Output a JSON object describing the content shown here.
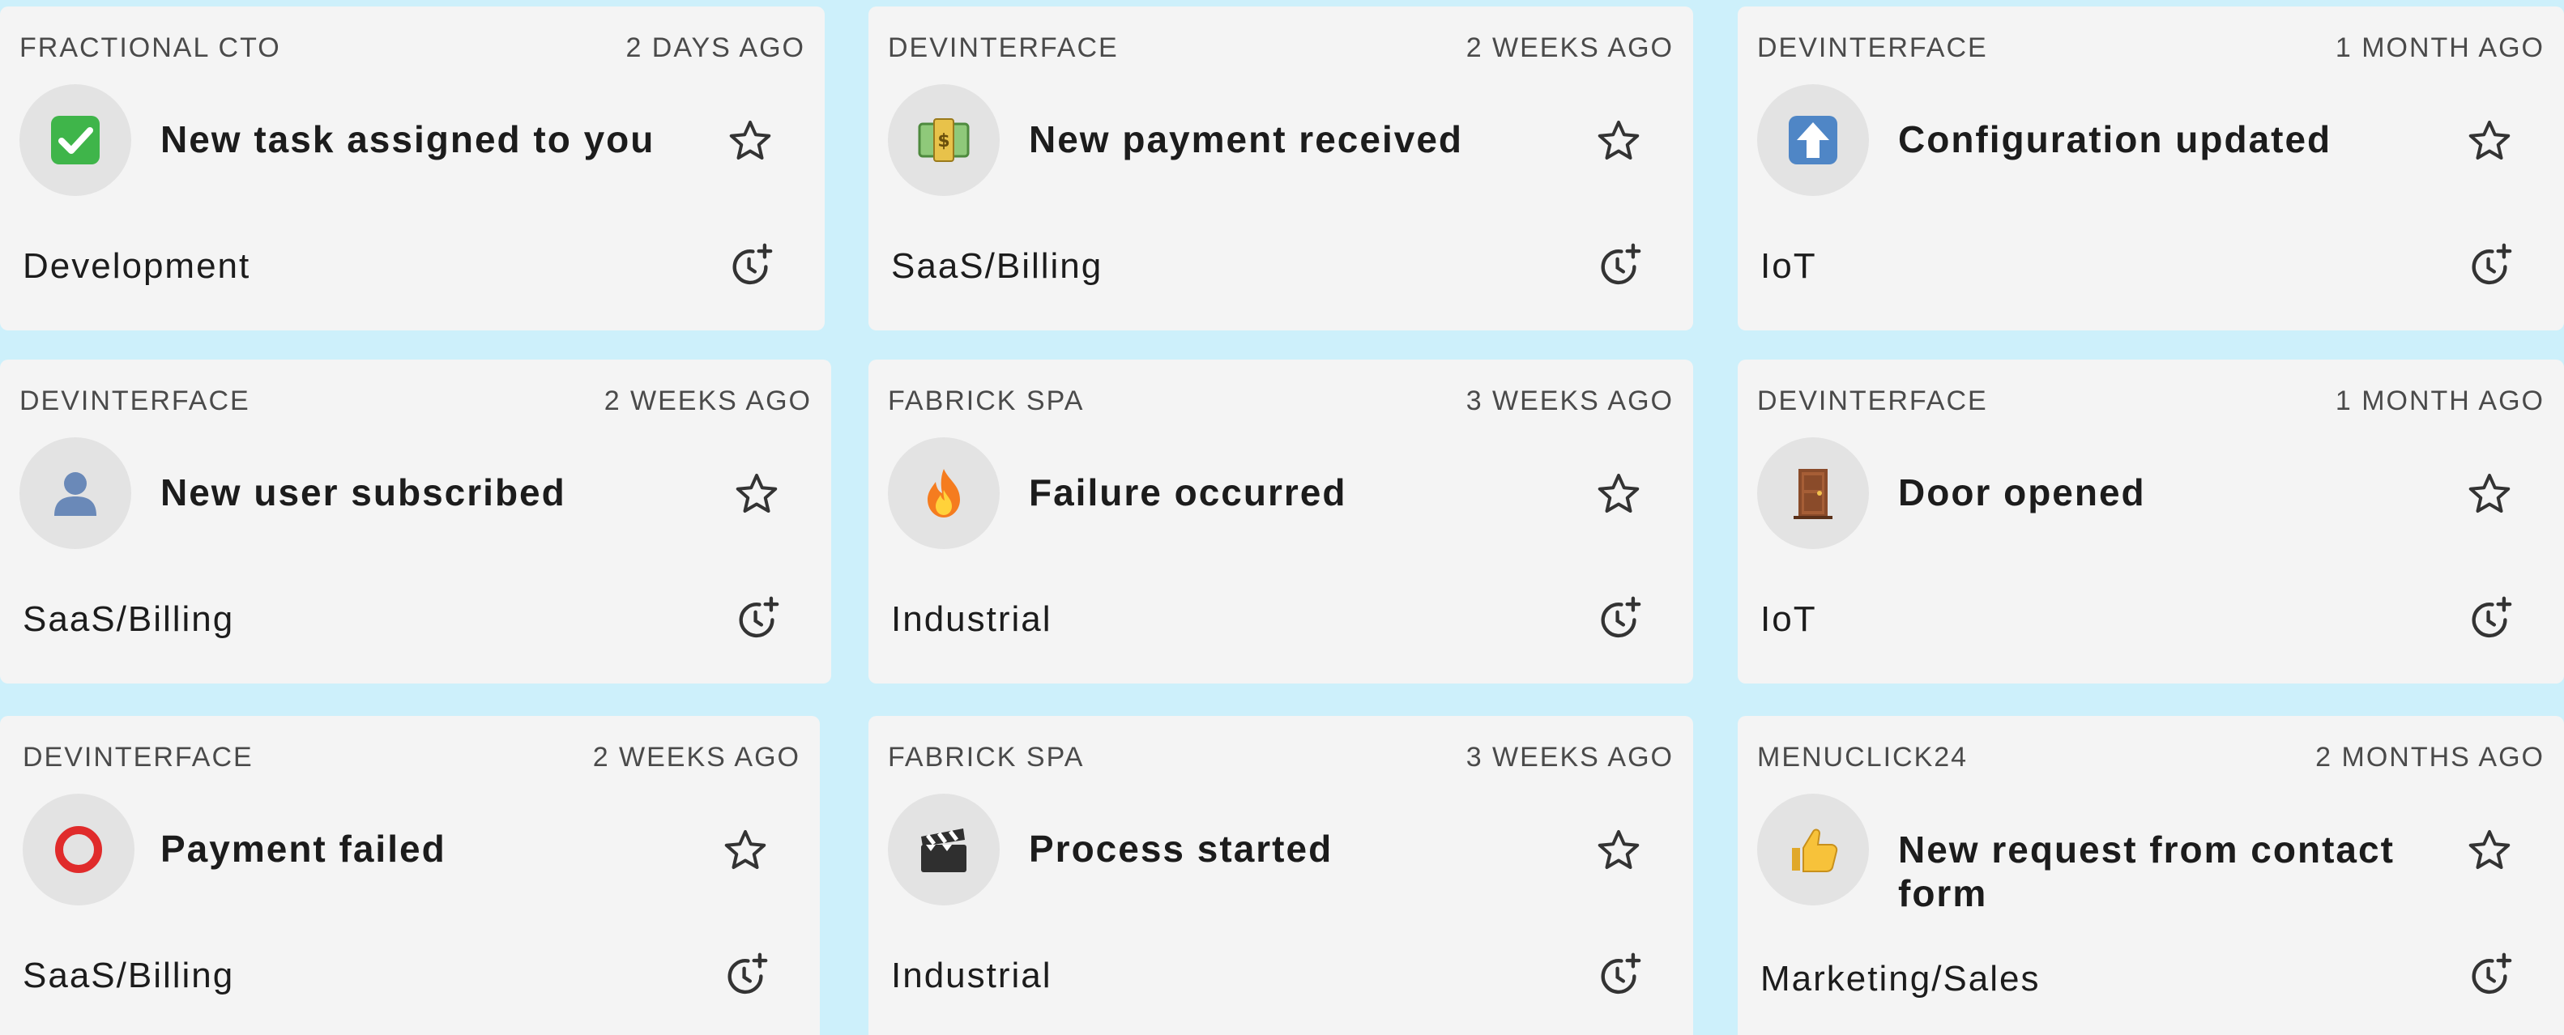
{
  "notifications": [
    {
      "org": "FRACTIONAL CTO",
      "time": "2 DAYS AGO",
      "icon": "check-mark-icon",
      "title": "New task assigned to you",
      "category": "Development"
    },
    {
      "org": "DEVINTERFACE",
      "time": "2 WEEKS AGO",
      "icon": "money-icon",
      "title": "New payment received",
      "category": "SaaS/Billing"
    },
    {
      "org": "DEVINTERFACE",
      "time": "1 MONTH AGO",
      "icon": "up-arrow-icon",
      "title": "Configuration updated",
      "category": "IoT"
    },
    {
      "org": "DEVINTERFACE",
      "time": "2 WEEKS AGO",
      "icon": "user-silhouette-icon",
      "title": "New user subscribed",
      "category": "SaaS/Billing"
    },
    {
      "org": "FABRICK SPA",
      "time": "3 WEEKS AGO",
      "icon": "fire-icon",
      "title": "Failure occurred",
      "category": "Industrial"
    },
    {
      "org": "DEVINTERFACE",
      "time": "1 MONTH AGO",
      "icon": "door-icon",
      "title": "Door opened",
      "category": "IoT"
    },
    {
      "org": "DEVINTERFACE",
      "time": "2 WEEKS AGO",
      "icon": "red-circle-icon",
      "title": "Payment failed",
      "category": "SaaS/Billing"
    },
    {
      "org": "FABRICK SPA",
      "time": "3 WEEKS AGO",
      "icon": "clapper-board-icon",
      "title": "Process started",
      "category": "Industrial"
    },
    {
      "org": "MENUCLICK24",
      "time": "2 MONTHS AGO",
      "icon": "thumbs-up-icon",
      "title": "New request from contact form",
      "category": "Marketing/Sales"
    }
  ],
  "colors": {
    "page_background": "#cdf0fb",
    "card_background": "#f4f4f4",
    "avatar_background": "#e3e3e3",
    "check_green": "#3fb54a",
    "money_green": "#8fc97a",
    "arrow_blue": "#4f86c6",
    "user_blue": "#6a89b8",
    "fire_orange": "#f57c1f",
    "door_brown": "#8a4b2a",
    "failed_red": "#e02b2b",
    "clapper_dark": "#2f2f2f",
    "thumb_yellow": "#f7c23a"
  }
}
